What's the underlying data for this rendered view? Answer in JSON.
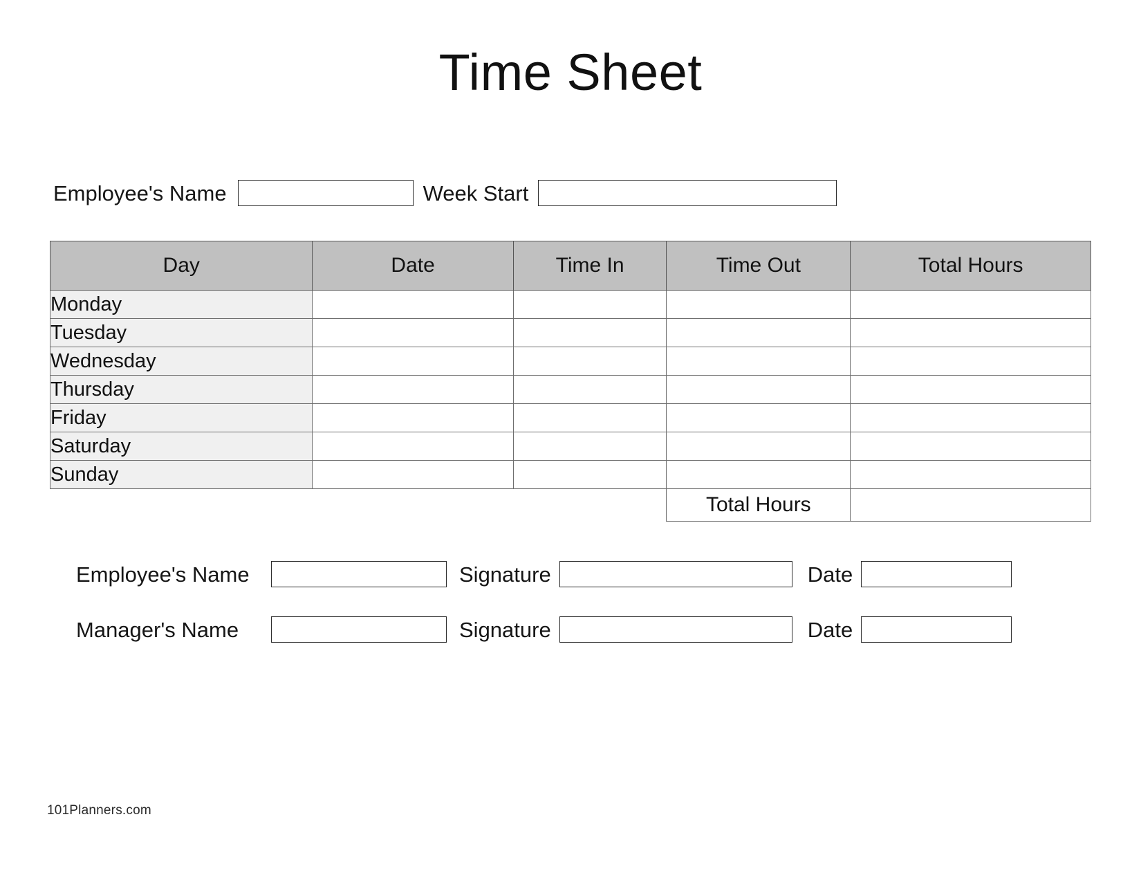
{
  "document": {
    "title": "Time Sheet"
  },
  "top_fields": {
    "employee_name_label": "Employee's Name",
    "employee_name_value": "",
    "week_start_label": "Week Start",
    "week_start_value": ""
  },
  "table": {
    "headers": [
      "Day",
      "Date",
      "Time In",
      "Time Out",
      "Total Hours"
    ],
    "rows": [
      {
        "day": "Monday",
        "date": "",
        "time_in": "",
        "time_out": "",
        "total_hours": ""
      },
      {
        "day": "Tuesday",
        "date": "",
        "time_in": "",
        "time_out": "",
        "total_hours": ""
      },
      {
        "day": "Wednesday",
        "date": "",
        "time_in": "",
        "time_out": "",
        "total_hours": ""
      },
      {
        "day": "Thursday",
        "date": "",
        "time_in": "",
        "time_out": "",
        "total_hours": ""
      },
      {
        "day": "Friday",
        "date": "",
        "time_in": "",
        "time_out": "",
        "total_hours": ""
      },
      {
        "day": "Saturday",
        "date": "",
        "time_in": "",
        "time_out": "",
        "total_hours": ""
      },
      {
        "day": "Sunday",
        "date": "",
        "time_in": "",
        "time_out": "",
        "total_hours": ""
      }
    ],
    "footer": {
      "total_label": "Total Hours",
      "total_value": ""
    }
  },
  "signatures": {
    "employee": {
      "name_label": "Employee's Name",
      "name_value": "",
      "signature_label": "Signature",
      "signature_value": "",
      "date_label": "Date",
      "date_value": ""
    },
    "manager": {
      "name_label": "Manager's Name",
      "name_value": "",
      "signature_label": "Signature",
      "signature_value": "",
      "date_label": "Date",
      "date_value": ""
    }
  },
  "footer": {
    "brand": "101Planners.com"
  },
  "colors": {
    "header_fill": "#c0c0c0",
    "day_fill": "#f0f0f0",
    "border": "#6d6d6d",
    "text": "#111111",
    "page_background": "#ffffff"
  }
}
